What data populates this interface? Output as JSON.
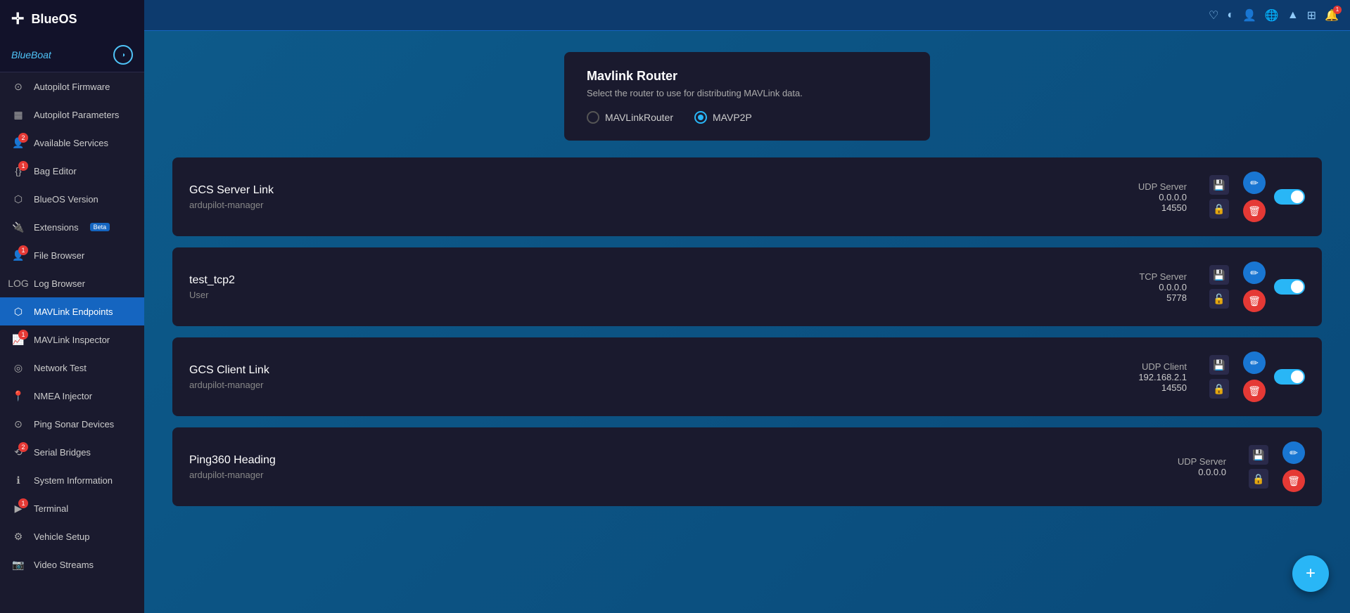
{
  "app": {
    "title": "BlueOS",
    "vehicle": "BlueBoat"
  },
  "sidebar": {
    "items": [
      {
        "id": "autopilot-firmware",
        "label": "Autopilot Firmware",
        "icon": "⊙",
        "badge": null
      },
      {
        "id": "autopilot-parameters",
        "label": "Autopilot Parameters",
        "icon": "▦",
        "badge": null
      },
      {
        "id": "available-services",
        "label": "Available Services",
        "icon": "👤",
        "badge": "2"
      },
      {
        "id": "bag-editor",
        "label": "Bag Editor",
        "icon": "{}",
        "badge": "1"
      },
      {
        "id": "blueos-version",
        "label": "BlueOS Version",
        "icon": "⬡",
        "badge": null
      },
      {
        "id": "extensions",
        "label": "Extensions",
        "icon": "🔌",
        "badge": null,
        "beta": true
      },
      {
        "id": "file-browser",
        "label": "File Browser",
        "icon": "👤",
        "badge": "1"
      },
      {
        "id": "log-browser",
        "label": "Log Browser",
        "icon": "LOG",
        "badge": null
      },
      {
        "id": "mavlink-endpoints",
        "label": "MAVLink Endpoints",
        "icon": "⬡",
        "badge": null,
        "active": true
      },
      {
        "id": "mavlink-inspector",
        "label": "MAVLink Inspector",
        "icon": "📈",
        "badge": "1"
      },
      {
        "id": "network-test",
        "label": "Network Test",
        "icon": "◎",
        "badge": null
      },
      {
        "id": "nmea-injector",
        "label": "NMEA Injector",
        "icon": "📍",
        "badge": null
      },
      {
        "id": "ping-sonar-devices",
        "label": "Ping Sonar Devices",
        "icon": "⊙",
        "badge": null
      },
      {
        "id": "serial-bridges",
        "label": "Serial Bridges",
        "icon": "⟲",
        "badge": "2"
      },
      {
        "id": "system-information",
        "label": "System Information",
        "icon": "ℹ",
        "badge": null
      },
      {
        "id": "terminal",
        "label": "Terminal",
        "icon": "▶",
        "badge": "1"
      },
      {
        "id": "vehicle-setup",
        "label": "Vehicle Setup",
        "icon": "⚙",
        "badge": null
      },
      {
        "id": "video-streams",
        "label": "Video Streams",
        "icon": "📷",
        "badge": null
      }
    ]
  },
  "router": {
    "title": "Mavlink Router",
    "description": "Select the router to use for distributing MAVLink data.",
    "options": [
      "MAVLinkRouter",
      "MAVP2P"
    ],
    "selected": "MAVP2P"
  },
  "endpoints": [
    {
      "id": "gcs-server-link",
      "name": "GCS Server Link",
      "owner": "ardupilot-manager",
      "type": "UDP Server",
      "ip": "0.0.0.0",
      "port": "14550",
      "enabled": true,
      "locked": true
    },
    {
      "id": "test-tcp2",
      "name": "test_tcp2",
      "owner": "User",
      "type": "TCP Server",
      "ip": "0.0.0.0",
      "port": "5778",
      "enabled": true,
      "locked": false
    },
    {
      "id": "gcs-client-link",
      "name": "GCS Client Link",
      "owner": "ardupilot-manager",
      "type": "UDP Client",
      "ip": "192.168.2.1",
      "port": "14550",
      "enabled": true,
      "locked": true
    },
    {
      "id": "ping360-heading",
      "name": "Ping360 Heading",
      "owner": "ardupilot-manager",
      "type": "UDP Server",
      "ip": "0.0.0.0",
      "port": "",
      "enabled": false,
      "locked": true
    }
  ],
  "fab": {
    "label": "+"
  },
  "topbar": {
    "icons": [
      "♡",
      "◐",
      "👤",
      "🌐",
      "WiFi",
      "⊞",
      "🔔"
    ]
  }
}
